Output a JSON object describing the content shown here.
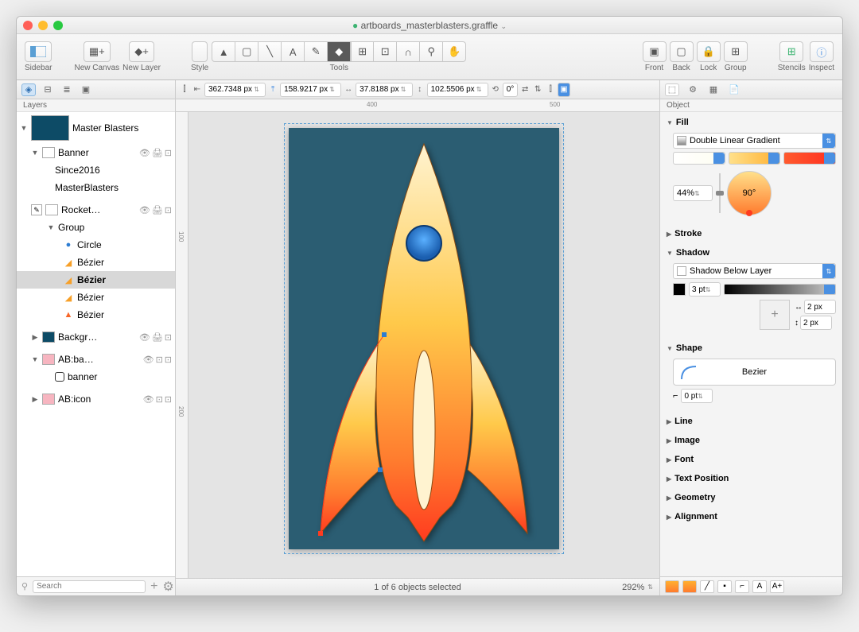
{
  "window": {
    "title": "artboards_masterblasters.graffle"
  },
  "toolbar": {
    "sidebar": "Sidebar",
    "new_canvas": "New Canvas",
    "new_layer": "New Layer",
    "style": "Style",
    "tools": "Tools",
    "front": "Front",
    "back": "Back",
    "lock": "Lock",
    "group": "Group",
    "stencils": "Stencils",
    "inspect": "Inspect"
  },
  "geometry": {
    "x": "362.7348 px",
    "y": "158.9217 px",
    "w": "37.8188 px",
    "h": "102.5506 px",
    "rot": "0°"
  },
  "sidebar": {
    "title": "Layers",
    "canvas": "Master Blasters",
    "items": [
      {
        "name": "Banner",
        "children": [
          "Since2016",
          "MasterBlasters"
        ]
      },
      {
        "name": "Rocket…",
        "group": "Group",
        "shapes": [
          "Circle",
          "Bézier",
          "Bézier",
          "Bézier",
          "Bézier"
        ]
      },
      {
        "name": "Backgr…"
      },
      {
        "name": "AB:ba…",
        "child": "banner"
      },
      {
        "name": "AB:icon"
      }
    ],
    "search_placeholder": "Search"
  },
  "rulers": {
    "h1": "400",
    "h2": "500",
    "v1": "100",
    "v2": "200"
  },
  "status": {
    "text": "1 of 6 objects selected",
    "zoom": "292%"
  },
  "inspector": {
    "title": "Object",
    "fill": {
      "label": "Fill",
      "type": "Double Linear Gradient",
      "pct": "44%",
      "angle": "90°"
    },
    "stroke": {
      "label": "Stroke"
    },
    "shadow": {
      "label": "Shadow",
      "type": "Shadow Below Layer",
      "blur": "3 pt",
      "ox": "2 px",
      "oy": "2 px"
    },
    "shape": {
      "label": "Shape",
      "name": "Bezier",
      "radius": "0 pt"
    },
    "line": "Line",
    "image": "Image",
    "font": "Font",
    "text_position": "Text Position",
    "geometry": "Geometry",
    "alignment": "Alignment"
  }
}
